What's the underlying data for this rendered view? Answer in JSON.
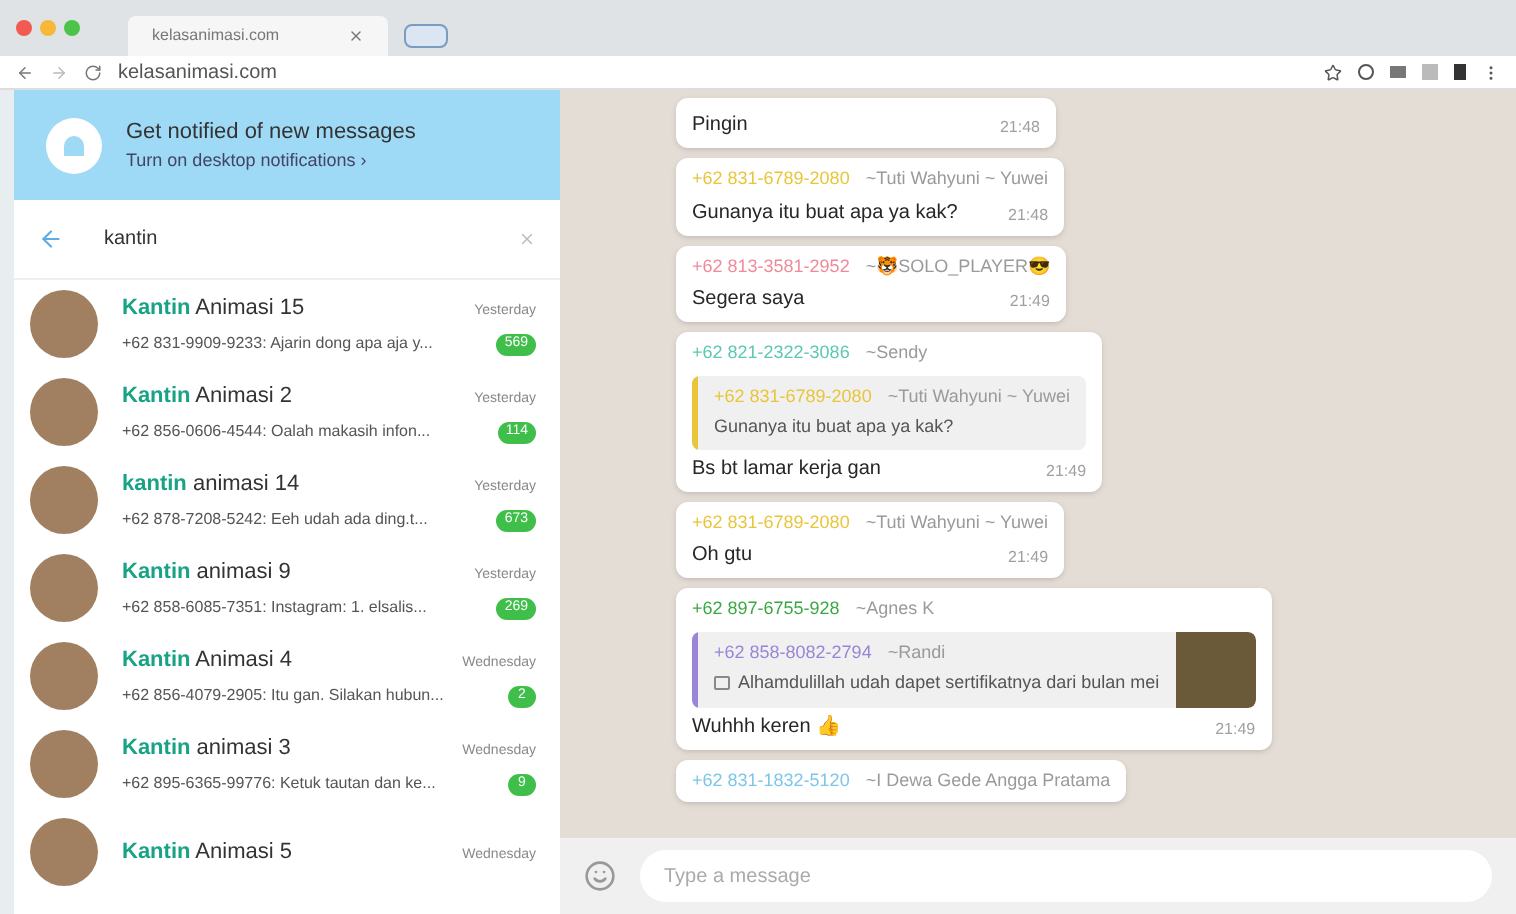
{
  "browser": {
    "tab_title": "kelasanimasi.com",
    "address": "kelasanimasi.com"
  },
  "notification": {
    "title": "Get notified of new messages",
    "link": "Turn on desktop notifications ›"
  },
  "search": {
    "value": "kantin"
  },
  "chats": [
    {
      "match": "Kantin",
      "rest": " Animasi 15",
      "time": "Yesterday",
      "preview": "+62 831-9909-9233: Ajarin dong apa aja y...",
      "badge": "569"
    },
    {
      "match": "Kantin",
      "rest": " Animasi 2",
      "time": "Yesterday",
      "preview": "+62 856-0606-4544: Oalah makasih infon...",
      "badge": "114"
    },
    {
      "match": "kantin",
      "rest": " animasi 14",
      "time": "Yesterday",
      "preview": "+62 878-7208-5242: Eeh udah ada ding.t...",
      "badge": "673"
    },
    {
      "match": "Kantin",
      "rest": " animasi 9",
      "time": "Yesterday",
      "preview": "+62 858-6085-7351: Instagram: 1. elsalis...",
      "badge": "269"
    },
    {
      "match": "Kantin",
      "rest": " Animasi 4",
      "time": "Wednesday",
      "preview": "+62 856-4079-2905: Itu gan. Silakan hubun...",
      "badge": "2"
    },
    {
      "match": "Kantin",
      "rest": " animasi 3",
      "time": "Wednesday",
      "preview": "+62 895-6365-99776: Ketuk tautan dan ke...",
      "badge": "9"
    },
    {
      "match": "Kantin",
      "rest": " Animasi 5",
      "time": "Wednesday"
    }
  ],
  "messages": [
    {
      "kind": "plain",
      "text": "Pingin",
      "time": "21:48"
    },
    {
      "kind": "plain",
      "phone": "+62 831-6789-2080",
      "name": "~Tuti Wahyuni ~ Yuwei",
      "color": "#e8c53a",
      "text": "Gunanya itu buat apa ya kak?",
      "time": "21:48"
    },
    {
      "kind": "plain",
      "phone": "+62 813-3581-2952",
      "name": "~🐯SOLO_PLAYER😎",
      "color": "#f08a9a",
      "text": "Segera saya",
      "time": "21:49"
    },
    {
      "kind": "quote",
      "phone": "+62 821-2322-3086",
      "name": "~Sendy",
      "color": "#5cc8b0",
      "quote": {
        "phone": "+62 831-6789-2080",
        "name": "~Tuti Wahyuni ~ Yuwei",
        "color": "#e8c53a",
        "text": "Gunanya itu buat apa ya kak?"
      },
      "text": "Bs bt lamar kerja gan",
      "time": "21:49"
    },
    {
      "kind": "plain",
      "phone": "+62 831-6789-2080",
      "name": "~Tuti Wahyuni ~ Yuwei",
      "color": "#e8c53a",
      "text": "Oh gtu",
      "time": "21:49"
    },
    {
      "kind": "image_quote",
      "phone": "+62 897-6755-928",
      "name": "~Agnes K",
      "color": "#3aa845",
      "quote": {
        "phone": "+62 858-8082-2794",
        "name": "~Randi",
        "color": "#9a85d6",
        "text": "Alhamdulillah udah dapet sertifikatnya dari bulan mei"
      },
      "text": "Wuhhh keren 👍",
      "time": "21:49"
    },
    {
      "kind": "header",
      "phone": "+62 831-1832-5120",
      "name": "~I Dewa Gede Angga Pratama",
      "color": "#7cc6e8"
    }
  ],
  "composer": {
    "placeholder": "Type a message"
  }
}
